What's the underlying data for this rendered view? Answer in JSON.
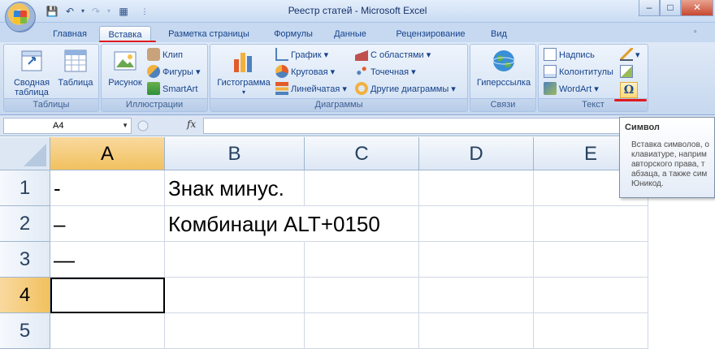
{
  "window": {
    "title": "Реестр статей - Microsoft Excel",
    "controls": [
      "–",
      "□",
      "✕"
    ]
  },
  "quick_access": [
    "save-icon",
    "undo-icon",
    "redo-icon",
    "layout-icon",
    "customize-icon"
  ],
  "tabs": [
    {
      "label": "Главная",
      "active": false
    },
    {
      "label": "Вставка",
      "active": true
    },
    {
      "label": "Разметка страницы",
      "active": false
    },
    {
      "label": "Формулы",
      "active": false
    },
    {
      "label": "Данные",
      "active": false
    },
    {
      "label": "Рецензирование",
      "active": false
    },
    {
      "label": "Вид",
      "active": false
    }
  ],
  "ribbon": {
    "tables": {
      "label": "Таблицы",
      "pivot": "Сводная таблица",
      "pivot_line1": "Сводная",
      "pivot_line2": "таблица",
      "table": "Таблица"
    },
    "illustrations": {
      "label": "Иллюстрации",
      "picture": "Рисунок",
      "clip": "Клип",
      "shapes": "Фигуры",
      "smartart": "SmartArt"
    },
    "charts": {
      "label": "Диаграммы",
      "histogram": "Гистограмма",
      "line": "График",
      "pie": "Круговая",
      "bar": "Линейчатая",
      "area": "С областями",
      "scatter": "Точечная",
      "other": "Другие диаграммы"
    },
    "links": {
      "label": "Связи",
      "hyperlink": "Гиперссылка"
    },
    "text": {
      "label": "Текст",
      "textbox": "Надпись",
      "header_footer": "Колонтитулы",
      "wordart": "WordArt",
      "symbol_glyph": "Ω"
    }
  },
  "formula_bar": {
    "name_box": "A4",
    "fx": "fx",
    "formula": ""
  },
  "columns": [
    "A",
    "B",
    "C",
    "D",
    "E"
  ],
  "rows": [
    "1",
    "2",
    "3",
    "4",
    "5"
  ],
  "cells": {
    "A1": "-",
    "B1": "Знак минус.",
    "A2": "–",
    "B2": "Комбинаци ALT+0150",
    "A3": "—"
  },
  "active_cell": "A4",
  "tooltip": {
    "title": "Символ",
    "lines": [
      "Вставка символов, о",
      "клавиатуре, наприм",
      "авторского права, т",
      "абзаца, а также сим",
      "Юникод."
    ]
  },
  "colors": {
    "accent_red": "#e0191e",
    "active_header": "#f1c15f",
    "ribbon_bg": "#dbe7f6"
  }
}
